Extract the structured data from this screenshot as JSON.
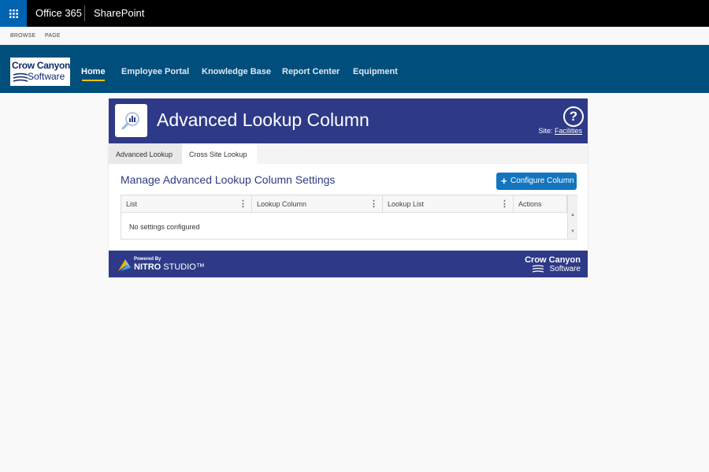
{
  "o365": {
    "app_launcher_icon": "waffle-icon",
    "title": "Office 365",
    "app": "SharePoint"
  },
  "ribbon": {
    "tabs": [
      "BROWSE",
      "PAGE"
    ]
  },
  "suite": {
    "logo": {
      "line1": "Crow Canyon",
      "line2": "Software"
    },
    "nav": [
      {
        "label": "Home",
        "active": true
      },
      {
        "label": "Employee Portal"
      },
      {
        "label": "Knowledge Base"
      },
      {
        "label": "Report Center"
      },
      {
        "label": "Equipment"
      }
    ],
    "colors": {
      "bar": "#004e7c",
      "active_underline": "#f0c400"
    }
  },
  "panel": {
    "title": "Advanced Lookup Column",
    "help_icon": "question-circle-icon",
    "site_label": "Site:",
    "site_link": "Facilities",
    "tabs": [
      {
        "label": "Advanced Lookup",
        "selected": false
      },
      {
        "label": "Cross Site Lookup",
        "selected": true
      }
    ],
    "section_title": "Manage Advanced Lookup Column Settings",
    "configure_button": "Configure Column",
    "columns": [
      "List",
      "Lookup Column",
      "Lookup List",
      "Actions"
    ],
    "empty_text": "No settings configured",
    "footer": {
      "powered_by": "Powered By",
      "product_bold": "NITRO",
      "product_rest": " STUDIO™",
      "brand_line1": "Crow Canyon",
      "brand_line2": "Software"
    },
    "colors": {
      "header": "#2e3a87",
      "button": "#1275c0"
    }
  }
}
